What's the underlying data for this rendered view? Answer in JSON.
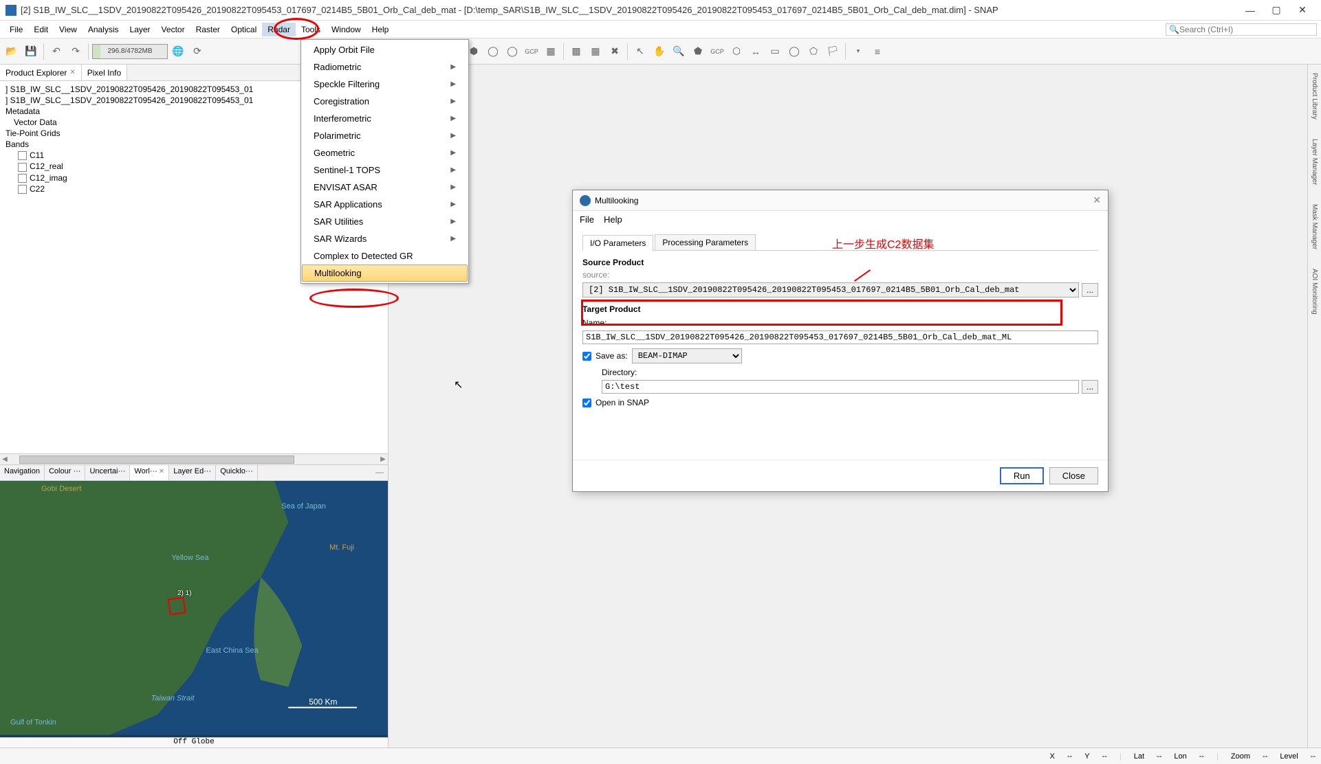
{
  "window": {
    "title": "[2] S1B_IW_SLC__1SDV_20190822T095426_20190822T095453_017697_0214B5_5B01_Orb_Cal_deb_mat - [D:\\temp_SAR\\S1B_IW_SLC__1SDV_20190822T095426_20190822T095453_017697_0214B5_5B01_Orb_Cal_deb_mat.dim] - SNAP"
  },
  "menubar": {
    "items": [
      "File",
      "Edit",
      "View",
      "Analysis",
      "Layer",
      "Vector",
      "Raster",
      "Optical",
      "Radar",
      "Tools",
      "Window",
      "Help"
    ],
    "search_placeholder": "Search (Ctrl+I)"
  },
  "toolbar": {
    "memory": "296.8/4782MB"
  },
  "radar_menu": {
    "items": [
      {
        "label": "Apply Orbit File",
        "sub": false
      },
      {
        "label": "Radiometric",
        "sub": true
      },
      {
        "label": "Speckle Filtering",
        "sub": true
      },
      {
        "label": "Coregistration",
        "sub": true
      },
      {
        "label": "Interferometric",
        "sub": true
      },
      {
        "label": "Polarimetric",
        "sub": true
      },
      {
        "label": "Geometric",
        "sub": true
      },
      {
        "label": "Sentinel-1 TOPS",
        "sub": true
      },
      {
        "label": "ENVISAT ASAR",
        "sub": true
      },
      {
        "label": "SAR Applications",
        "sub": true
      },
      {
        "label": "SAR Utilities",
        "sub": true
      },
      {
        "label": "SAR Wizards",
        "sub": true
      },
      {
        "label": "Complex to Detected GR",
        "sub": false
      },
      {
        "label": "Multilooking",
        "sub": false,
        "highlighted": true
      }
    ]
  },
  "explorer": {
    "tabs": [
      {
        "label": "Product Explorer",
        "closeable": true,
        "active": true
      },
      {
        "label": "Pixel Info",
        "closeable": false
      }
    ],
    "tree": [
      {
        "label": "S1B_IW_SLC__1SDV_20190822T095426_20190822T095453_01",
        "indent": 0,
        "icon": "product"
      },
      {
        "label": "S1B_IW_SLC__1SDV_20190822T095426_20190822T095453_01",
        "indent": 0,
        "icon": "product"
      },
      {
        "label": "Metadata",
        "indent": 0,
        "icon": "folder"
      },
      {
        "label": "Vector Data",
        "indent": 1,
        "icon": "folder"
      },
      {
        "label": "Tie-Point Grids",
        "indent": 0,
        "icon": "folder"
      },
      {
        "label": "Bands",
        "indent": 0,
        "icon": "folder"
      },
      {
        "label": "C11",
        "indent": 1,
        "icon": "band"
      },
      {
        "label": "C12_real",
        "indent": 1,
        "icon": "band"
      },
      {
        "label": "C12_imag",
        "indent": 1,
        "icon": "band"
      },
      {
        "label": "C22",
        "indent": 1,
        "icon": "band"
      }
    ]
  },
  "lower_tabs": {
    "items": [
      {
        "label": "Navigation"
      },
      {
        "label": "Colour ···"
      },
      {
        "label": "Uncertai···"
      },
      {
        "label": "Worl···",
        "active": true,
        "closeable": true
      },
      {
        "label": "Layer Ed···"
      },
      {
        "label": "Quicklo···"
      }
    ]
  },
  "map": {
    "labels": [
      "Gobi Desert",
      "Sea of Japan",
      "Yellow Sea",
      "Mt. Fuji",
      "East China Sea",
      "Taiwan Strait",
      "Gulf of Tonkin"
    ],
    "scale": "500 Km",
    "status": "Off Globe",
    "footprint_label": "2)\n1)"
  },
  "dialog": {
    "title": "Multilooking",
    "menus": [
      "File",
      "Help"
    ],
    "tabs": [
      "I/O Parameters",
      "Processing Parameters"
    ],
    "source_section": "Source Product",
    "source_label": "source:",
    "source_value": "[2] S1B_IW_SLC__1SDV_20190822T095426_20190822T095453_017697_0214B5_5B01_Orb_Cal_deb_mat",
    "target_section": "Target Product",
    "name_label": "Name:",
    "name_value": "S1B_IW_SLC__1SDV_20190822T095426_20190822T095453_017697_0214B5_5B01_Orb_Cal_deb_mat_ML",
    "save_as_label": "Save as:",
    "save_as_value": "BEAM-DIMAP",
    "directory_label": "Directory:",
    "directory_value": "G:\\test",
    "open_in_snap_label": "Open in SNAP",
    "run": "Run",
    "close": "Close",
    "browse": "..."
  },
  "annotations": {
    "cn_text": "上一步生成C2数据集"
  },
  "right_sidebar": {
    "tabs": [
      "Product Library",
      "Layer Manager",
      "Mask Manager",
      "AOI Monitoring"
    ]
  },
  "statusbar": {
    "x": "X",
    "x_val": "--",
    "y": "Y",
    "y_val": "--",
    "lat": "Lat",
    "lat_val": "--",
    "lon": "Lon",
    "lon_val": "--",
    "zoom": "Zoom",
    "zoom_val": "--",
    "level": "Level",
    "level_val": "--"
  }
}
